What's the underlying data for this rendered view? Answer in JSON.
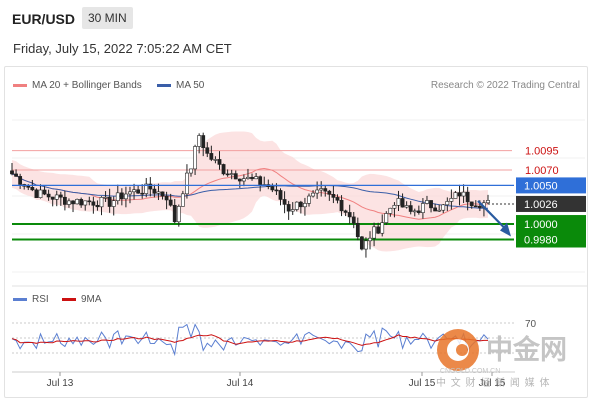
{
  "header": {
    "symbol": "EUR/USD",
    "timeframe": "30 MIN",
    "datetime": "Friday, July 15, 2022 7:05:22 AM CET"
  },
  "legend": {
    "ma20": "MA 20 + Bollinger Bands",
    "ma50": "MA 50",
    "ma20_color": "#f08080",
    "ma50_color": "#3a5ea8",
    "credit": "Research © 2022 Trading Central"
  },
  "rsi_legend": {
    "rsi": "RSI",
    "ma9": "9MA",
    "rsi_color": "#5b7fd1",
    "ma9_color": "#cc1111"
  },
  "watermark": {
    "name": "中金网",
    "subtitle": "中 文 财 经 新 闻 媒 体",
    "url": "CNGOLD.COM.CN"
  },
  "chart_data": {
    "type": "candlestick",
    "title": "",
    "x_ticks": [
      "Jul 13",
      "Jul 14",
      "Jul 15",
      "Jul 15"
    ],
    "ylim": [
      0.9925,
      1.0145
    ],
    "price_last": 1.0026,
    "resistance_levels": [
      {
        "label": "1.0095",
        "value": 1.0095,
        "color": "#cc1111"
      },
      {
        "label": "1.0070",
        "value": 1.007,
        "color": "#cc1111"
      }
    ],
    "support_levels": [
      {
        "label": "1.0000",
        "value": 1.0,
        "color": "#0a8a0a"
      },
      {
        "label": "0.9980",
        "value": 0.998,
        "color": "#0a8a0a"
      }
    ],
    "price_tags": [
      {
        "label": "1.0050",
        "value": 1.005,
        "color": "#2f6fd8"
      },
      {
        "label": "1.0026",
        "value": 1.0026,
        "color": "#333333"
      }
    ],
    "forecast": {
      "from_value": 1.0026,
      "to_value": 0.998,
      "color": "#2a5ba0"
    },
    "rsi": {
      "level": 70,
      "level_label": "70"
    }
  }
}
